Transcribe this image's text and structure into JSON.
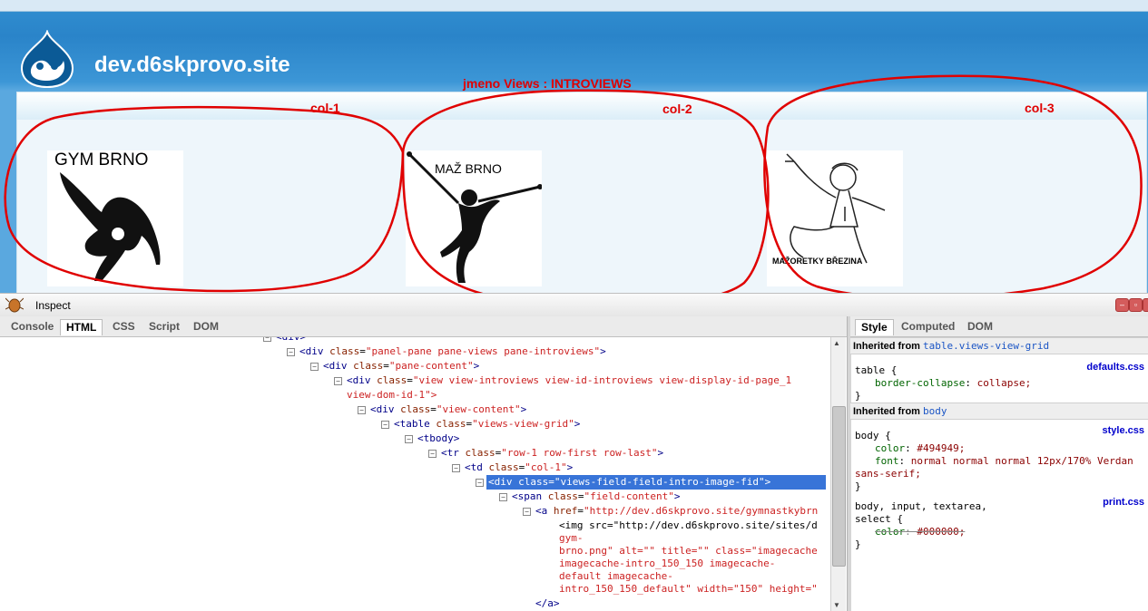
{
  "site": {
    "name": "dev.d6skprovo.site"
  },
  "annotations": {
    "views_name": "jmeno Views : INTROVIEWS",
    "col1": "col-1",
    "col2": "col-2",
    "col3": "col-3"
  },
  "thumbnails": {
    "gym": "GYM BRNO",
    "maz": "MAŽ BRNO",
    "majoretky": "MAŽORETKY BŘEZINA"
  },
  "firebug": {
    "inspect_label": "Inspect",
    "tabs": [
      "Console",
      "HTML",
      "CSS",
      "Script",
      "DOM"
    ],
    "active_tab": "HTML",
    "side_tabs": [
      "Style",
      "Computed",
      "DOM"
    ],
    "active_side_tab": "Style"
  },
  "html_tree": {
    "l0": "<div>",
    "l1": {
      "tag": "div",
      "attr": "class",
      "val": "panel-pane pane-views pane-introviews"
    },
    "l2": {
      "tag": "div",
      "attr": "class",
      "val": "pane-content"
    },
    "l3": {
      "tag": "div",
      "attr": "class",
      "val": "view view-introviews view-id-introviews view-display-id-page_1",
      "cont": "view-dom-id-1\">"
    },
    "l4": {
      "tag": "div",
      "attr": "class",
      "val": "view-content"
    },
    "l5": {
      "tag": "table",
      "attr": "class",
      "val": "views-view-grid"
    },
    "l6": "<tbody>",
    "l7": {
      "tag": "tr",
      "attr": "class",
      "val": "row-1 row-first row-last"
    },
    "l8": {
      "tag": "td",
      "attr": "class",
      "val": "col-1"
    },
    "l9": "<div class=\"views-field-field-intro-image-fid\">",
    "l10": {
      "tag": "span",
      "attr": "class",
      "val": "field-content"
    },
    "l11": {
      "tag": "a",
      "attr": "href",
      "val": "http://dev.d6skprovo.site/gymnastkybrn"
    },
    "l12a": "<img src=\"http://dev.d6skprovo.site/sites/d",
    "l12b": "gym-",
    "l12c": "brno.png\" alt=\"\" title=\"\" class=\"imagecache",
    "l12d": "imagecache-intro_150_150 imagecache-",
    "l12e": "default imagecache-",
    "l12f": "intro_150_150_default\" width=\"150\" height=\"",
    "l13": "</a>"
  },
  "styles": {
    "inherit1_label": "Inherited from",
    "inherit1_ref": "table.views-view-grid",
    "rule1_src": "defaults.css",
    "rule1_sel": "table {",
    "rule1_prop": "border-collapse",
    "rule1_val": "collapse;",
    "inherit2_label": "Inherited from",
    "inherit2_ref": "body",
    "rule2_src": "style.css",
    "rule2_sel": "body {",
    "rule2_p1": "color",
    "rule2_v1": "#494949;",
    "rule2_p2": "font",
    "rule2_v2": "normal normal normal 12px/170% Verdan",
    "rule2_v2b": "sans-serif;",
    "rule3_src": "print.css",
    "rule3_sel1": "body, input, textarea,",
    "rule3_sel2": "select {",
    "rule3_p1": "color",
    "rule3_v1": "#000000;",
    "close_brace": "}"
  },
  "colors": {
    "annotation_red": "#e00000",
    "header_blue": "#2a84c9",
    "selection_blue": "#3874d8"
  }
}
